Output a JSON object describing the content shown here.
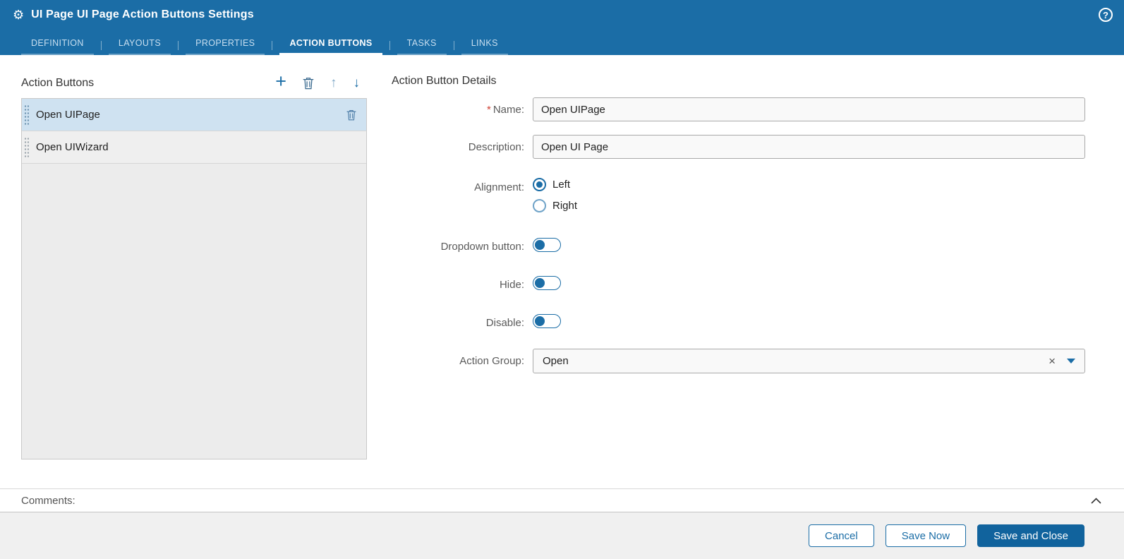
{
  "header": {
    "title": "UI Page UI Page Action Buttons Settings",
    "tabs": [
      {
        "label": "DEFINITION"
      },
      {
        "label": "LAYOUTS"
      },
      {
        "label": "PROPERTIES"
      },
      {
        "label": "ACTION BUTTONS"
      },
      {
        "label": "TASKS"
      },
      {
        "label": "LINKS"
      }
    ],
    "active_tab": "ACTION BUTTONS",
    "help_icon": "?"
  },
  "action_buttons_panel": {
    "title": "Action Buttons",
    "toolbar": {
      "add_icon": "+",
      "delete_icon": "trash",
      "move_up_icon": "↑",
      "move_down_icon": "↓"
    },
    "items": [
      {
        "label": "Open UIPage",
        "selected": true
      },
      {
        "label": "Open UIWizard",
        "selected": false
      }
    ]
  },
  "details": {
    "title": "Action Button Details",
    "required_marker": "*",
    "name_label": "Name:",
    "name_value": "Open UIPage",
    "description_label": "Description:",
    "description_value": "Open UI Page",
    "alignment_label": "Alignment:",
    "alignment_options": [
      {
        "label": "Left",
        "selected": true
      },
      {
        "label": "Right",
        "selected": false
      }
    ],
    "dropdown_button_label": "Dropdown button:",
    "dropdown_button_on": false,
    "hide_label": "Hide:",
    "hide_on": false,
    "disable_label": "Disable:",
    "disable_on": false,
    "action_group_label": "Action Group:",
    "action_group_value": "Open",
    "action_group_clear_icon": "×"
  },
  "comments": {
    "label": "Comments:"
  },
  "footer": {
    "cancel_label": "Cancel",
    "save_now_label": "Save Now",
    "save_and_close_label": "Save and Close"
  },
  "colors": {
    "header_blue": "#1b6da6",
    "accent_blue": "#1b6da6",
    "primary_button_blue": "#11639d",
    "selected_row_blue": "#cfe2f1",
    "required_red": "#cf4336"
  }
}
